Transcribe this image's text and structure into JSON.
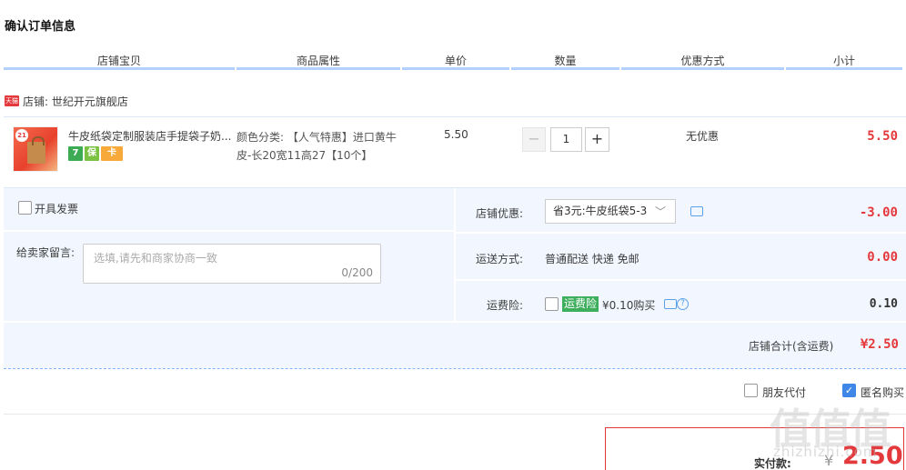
{
  "page_title": "确认订单信息",
  "columns": [
    "店铺宝贝",
    "商品属性",
    "单价",
    "数量",
    "优惠方式",
    "小计"
  ],
  "shop": {
    "tag": "天猫",
    "name": "店铺: 世纪开元旗舰店"
  },
  "item": {
    "thumb_badge": "21",
    "title": "牛皮纸袋定制服装店手提袋子奶...",
    "service_icons": [
      "7",
      "保",
      "卡"
    ],
    "attr": "颜色分类: 【人气特惠】进口黄牛皮-长20宽11高27【10个】",
    "price": "5.50",
    "qty_minus": "−",
    "qty": "1",
    "qty_plus": "+",
    "discount_mode": "无优惠",
    "subtotal": "5.50"
  },
  "options": {
    "invoice_label": "开具发票",
    "message_label": "给卖家留言:",
    "message_placeholder": "选填,请先和商家协商一致",
    "message_count": "0/200",
    "shop_discount_label": "店铺优惠:",
    "shop_discount_select": "省3元:牛皮纸袋5-3",
    "shop_discount_value": "-3.00",
    "shipping_label": "运送方式:",
    "shipping_value": "普通配送 快递 免邮",
    "shipping_fee": "0.00",
    "insurance_label": "运费险:",
    "insurance_tag": "运费险",
    "insurance_price": "¥0.10购买",
    "insurance_help": "?",
    "insurance_value": "0.10"
  },
  "shop_total": {
    "label": "店铺合计(含运费)",
    "value": "¥2.50"
  },
  "pay_options": {
    "friend_pay": "朋友代付",
    "anonymous": "匿名购买",
    "anonymous_checked": true
  },
  "payment": {
    "label": "实付款:",
    "currency": "¥",
    "value": "2.50"
  },
  "watermark": {
    "glyphs": "值值值",
    "site": "zhizhizhi.com"
  },
  "colors": {
    "accent_red": "#e4393c",
    "header_line": "#b2d1ff",
    "panel_bg": "#f2f7ff",
    "check_blue": "#3f86e8",
    "insurance_green": "#3dae5c"
  }
}
